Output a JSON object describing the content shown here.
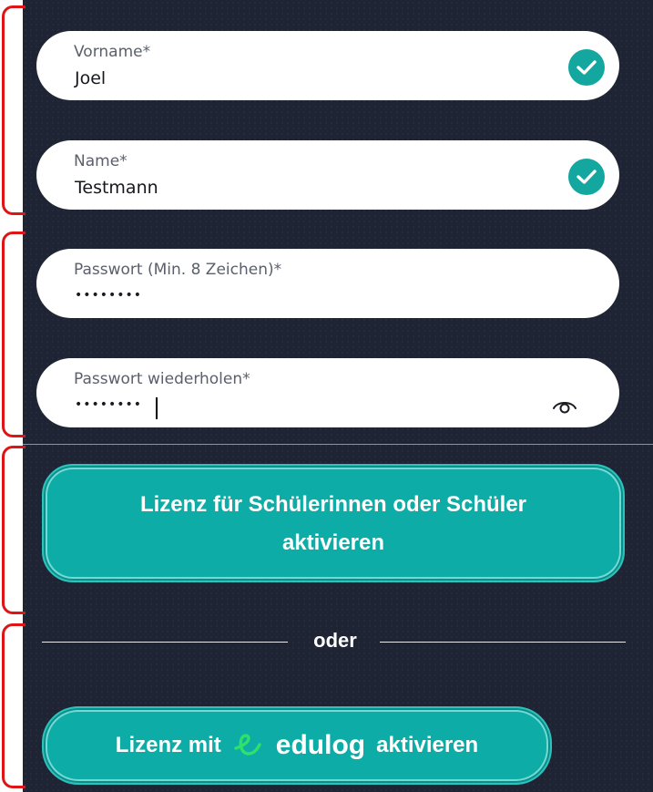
{
  "form": {
    "first_name": {
      "label": "Vorname*",
      "value": "Joel"
    },
    "last_name": {
      "label": "Name*",
      "value": "Testmann"
    },
    "password": {
      "label": "Passwort (Min. 8 Zeichen)*",
      "value": "••••••••"
    },
    "password_repeat": {
      "label": "Passwort wiederholen*",
      "value": "••••••••"
    }
  },
  "actions": {
    "activate_student_license": "Lizenz für Schülerinnen oder Schüler aktivieren",
    "separator": "oder",
    "edulog_prefix": "Lizenz mit",
    "edulog_brand": "edulog",
    "edulog_suffix": "aktivieren"
  },
  "icons": {
    "valid": "checkmark-circle-icon",
    "toggle_visibility": "eye-icon",
    "edulog_logo": "edulog-logo-icon"
  },
  "colors": {
    "background": "#1e2433",
    "accent": "#0eaca7",
    "annotation": "#e01414",
    "edulog_green": "#2fe06a"
  }
}
